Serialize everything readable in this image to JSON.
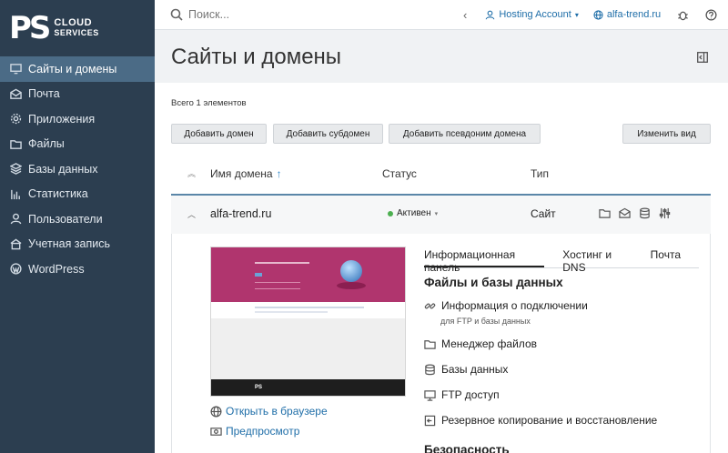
{
  "logo": {
    "mark": "PS",
    "line1": "CLOUD",
    "line2": "SERVICES"
  },
  "sidebar": {
    "items": [
      {
        "label": "Сайты и домены",
        "icon": "monitor-icon",
        "active": true
      },
      {
        "label": "Почта",
        "icon": "mail-icon"
      },
      {
        "label": "Приложения",
        "icon": "gear-icon"
      },
      {
        "label": "Файлы",
        "icon": "folder-icon"
      },
      {
        "label": "Базы данных",
        "icon": "layers-icon"
      },
      {
        "label": "Статистика",
        "icon": "bar-chart-icon"
      },
      {
        "label": "Пользователи",
        "icon": "user-icon"
      },
      {
        "label": "Учетная запись",
        "icon": "account-icon"
      },
      {
        "label": "WordPress",
        "icon": "wordpress-icon"
      }
    ]
  },
  "topbar": {
    "search_placeholder": "Поиск...",
    "back": "‹",
    "account": "Hosting Account",
    "domain": "alfa-trend.ru"
  },
  "page": {
    "title": "Сайты и домены"
  },
  "list": {
    "count": "Всего 1 элементов",
    "buttons": {
      "add_domain": "Добавить домен",
      "add_subdomain": "Добавить субдомен",
      "add_alias": "Добавить псевдоним домена",
      "change_view": "Изменить вид"
    },
    "columns": {
      "name": "Имя домена",
      "status": "Статус",
      "type": "Тип"
    },
    "sort_arrow": "↑",
    "row": {
      "name": "alfa-trend.ru",
      "status": "Активен",
      "type": "Сайт"
    }
  },
  "preview": {
    "footer": "PS",
    "links": {
      "open_browser": "Открыть в браузере",
      "preview": "Предпросмотр"
    }
  },
  "tabs": {
    "info": "Информационная панель",
    "hosting": "Хостинг и DNS",
    "mail": "Почта"
  },
  "files_section": {
    "title": "Файлы и базы данных",
    "connection": "Информация о подключении",
    "connection_sub": "для FTP и базы данных",
    "file_manager": "Менеджер файлов",
    "databases": "Базы данных",
    "ftp": "FTP доступ",
    "backup": "Резервное копирование и восстановление"
  },
  "security_section": {
    "title": "Безопасность"
  },
  "colors": {
    "sidebar": "#2c3e50",
    "active": "#4b6b86",
    "link": "#1f6ea8",
    "status_ok": "#4caf50"
  }
}
